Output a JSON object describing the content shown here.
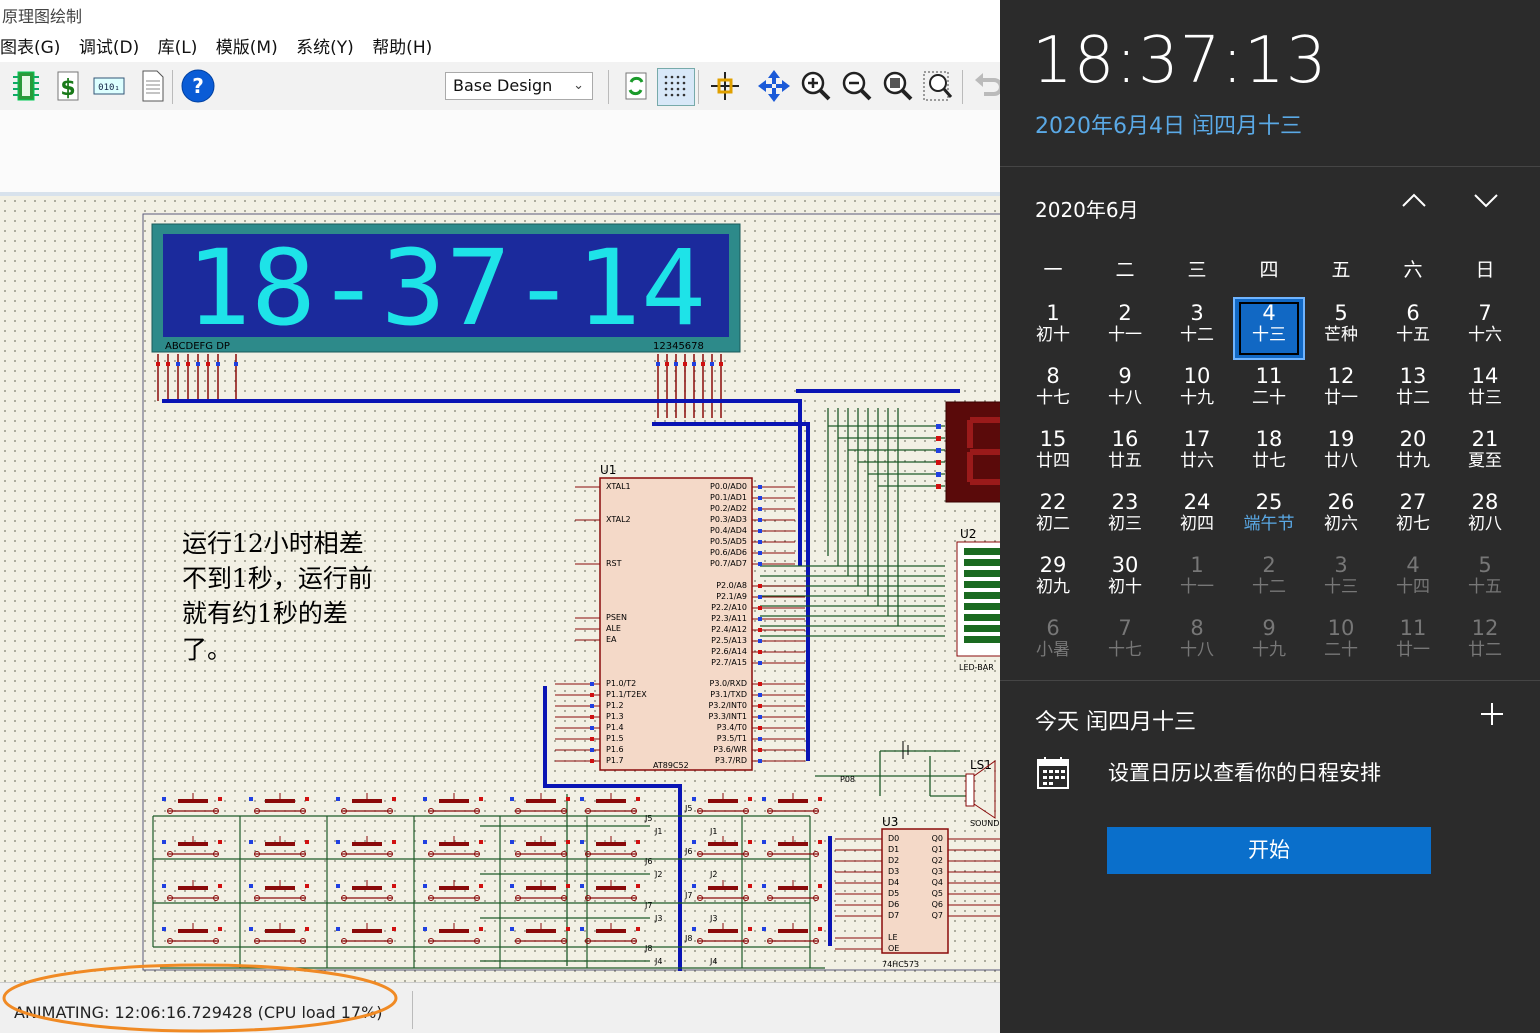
{
  "window": {
    "title": "原理图绘制"
  },
  "menu": [
    "图表(G)",
    "调试(D)",
    "库(L)",
    "模版(M)",
    "系统(Y)",
    "帮助(H)"
  ],
  "toolbar": {
    "design_select": "Base Design"
  },
  "schematic": {
    "display_text": "18-37-14",
    "display_left_label": "ABCDEFG  DP",
    "display_right_label": "12345678",
    "note_lines": [
      "运行12小时相差",
      "不到1秒，运行前",
      "就有约1秒的差",
      "了。"
    ],
    "u1_ref": "U1",
    "u1_part": "AT89C52",
    "u2_ref": "U2",
    "u2_part": "LED-BAR",
    "u3_ref": "U3",
    "u3_part": "74HC573",
    "ls1_ref": "LS1",
    "ls1_part": "SOUND",
    "u1_left_pins": [
      "XTAL1",
      "XTAL2",
      "RST",
      "PSEN",
      "ALE",
      "EA",
      "P1.0/T2",
      "P1.1/T2EX",
      "P1.2",
      "P1.3",
      "P1.4",
      "P1.5",
      "P1.6",
      "P1.7"
    ],
    "u1_right_pins": [
      "P0.0/AD0",
      "P0.1/AD1",
      "P0.2/AD2",
      "P0.3/AD3",
      "P0.4/AD4",
      "P0.5/AD5",
      "P0.6/AD6",
      "P0.7/AD7",
      "P2.0/A8",
      "P2.1/A9",
      "P2.2/A10",
      "P2.3/A11",
      "P2.4/A12",
      "P2.5/A13",
      "P2.6/A14",
      "P2.7/A15",
      "P3.0/RXD",
      "P3.1/TXD",
      "P3.2/INT0",
      "P3.3/INT1",
      "P3.4/T0",
      "P3.5/T1",
      "P3.6/WR",
      "P3.7/RD"
    ],
    "u3_left_pins": [
      "D0",
      "D1",
      "D2",
      "D3",
      "D4",
      "D5",
      "D6",
      "D7",
      "LE",
      "OE"
    ],
    "u3_right_pins": [
      "Q0",
      "Q1",
      "Q2",
      "Q3",
      "Q4",
      "Q5",
      "Q6",
      "Q7"
    ],
    "net_p08": "P08"
  },
  "status": {
    "text": "ANIMATING: 12:06:16.729428 (CPU load 17%)"
  },
  "flyout": {
    "time": "18:37:13",
    "date": "2020年6月4日 闰四月十三",
    "month_title": "2020年6月",
    "weekdays": [
      "一",
      "二",
      "三",
      "四",
      "五",
      "六",
      "日"
    ],
    "weeks": [
      [
        {
          "n": "1",
          "l": "初十",
          "t": "cur"
        },
        {
          "n": "2",
          "l": "十一",
          "t": "cur"
        },
        {
          "n": "3",
          "l": "十二",
          "t": "cur"
        },
        {
          "n": "4",
          "l": "十三",
          "t": "today"
        },
        {
          "n": "5",
          "l": "芒种",
          "t": "cur"
        },
        {
          "n": "6",
          "l": "十五",
          "t": "cur"
        },
        {
          "n": "7",
          "l": "十六",
          "t": "cur"
        }
      ],
      [
        {
          "n": "8",
          "l": "十七",
          "t": "cur"
        },
        {
          "n": "9",
          "l": "十八",
          "t": "cur"
        },
        {
          "n": "10",
          "l": "十九",
          "t": "cur"
        },
        {
          "n": "11",
          "l": "二十",
          "t": "cur"
        },
        {
          "n": "12",
          "l": "廿一",
          "t": "cur"
        },
        {
          "n": "13",
          "l": "廿二",
          "t": "cur"
        },
        {
          "n": "14",
          "l": "廿三",
          "t": "cur"
        }
      ],
      [
        {
          "n": "15",
          "l": "廿四",
          "t": "cur"
        },
        {
          "n": "16",
          "l": "廿五",
          "t": "cur"
        },
        {
          "n": "17",
          "l": "廿六",
          "t": "cur"
        },
        {
          "n": "18",
          "l": "廿七",
          "t": "cur"
        },
        {
          "n": "19",
          "l": "廿八",
          "t": "cur"
        },
        {
          "n": "20",
          "l": "廿九",
          "t": "cur"
        },
        {
          "n": "21",
          "l": "夏至",
          "t": "cur"
        }
      ],
      [
        {
          "n": "22",
          "l": "初二",
          "t": "cur"
        },
        {
          "n": "23",
          "l": "初三",
          "t": "cur"
        },
        {
          "n": "24",
          "l": "初四",
          "t": "cur"
        },
        {
          "n": "25",
          "l": "端午节",
          "t": "fest"
        },
        {
          "n": "26",
          "l": "初六",
          "t": "cur"
        },
        {
          "n": "27",
          "l": "初七",
          "t": "cur"
        },
        {
          "n": "28",
          "l": "初八",
          "t": "cur"
        }
      ],
      [
        {
          "n": "29",
          "l": "初九",
          "t": "cur"
        },
        {
          "n": "30",
          "l": "初十",
          "t": "cur"
        },
        {
          "n": "1",
          "l": "十一",
          "t": "other"
        },
        {
          "n": "2",
          "l": "十二",
          "t": "other"
        },
        {
          "n": "3",
          "l": "十三",
          "t": "other"
        },
        {
          "n": "4",
          "l": "十四",
          "t": "other"
        },
        {
          "n": "5",
          "l": "十五",
          "t": "other"
        }
      ],
      [
        {
          "n": "6",
          "l": "小暑",
          "t": "other"
        },
        {
          "n": "7",
          "l": "十七",
          "t": "other"
        },
        {
          "n": "8",
          "l": "十八",
          "t": "other"
        },
        {
          "n": "9",
          "l": "十九",
          "t": "other"
        },
        {
          "n": "10",
          "l": "二十",
          "t": "other"
        },
        {
          "n": "11",
          "l": "廿一",
          "t": "other"
        },
        {
          "n": "12",
          "l": "廿二",
          "t": "other"
        }
      ]
    ],
    "agenda_title": "今天 闰四月十三",
    "agenda_text": "设置日历以查看你的日程安排",
    "start_button": "开始"
  },
  "colors": {
    "accent_blue": "#0a6fcb",
    "date_blue": "#5aa9e6",
    "wire_blue": "#0a14b4",
    "wire_green": "#1e5a28",
    "segment_cyan": "#1ee3e8",
    "display_bg": "#1b2a9c",
    "annotation_orange": "#f08a24"
  }
}
